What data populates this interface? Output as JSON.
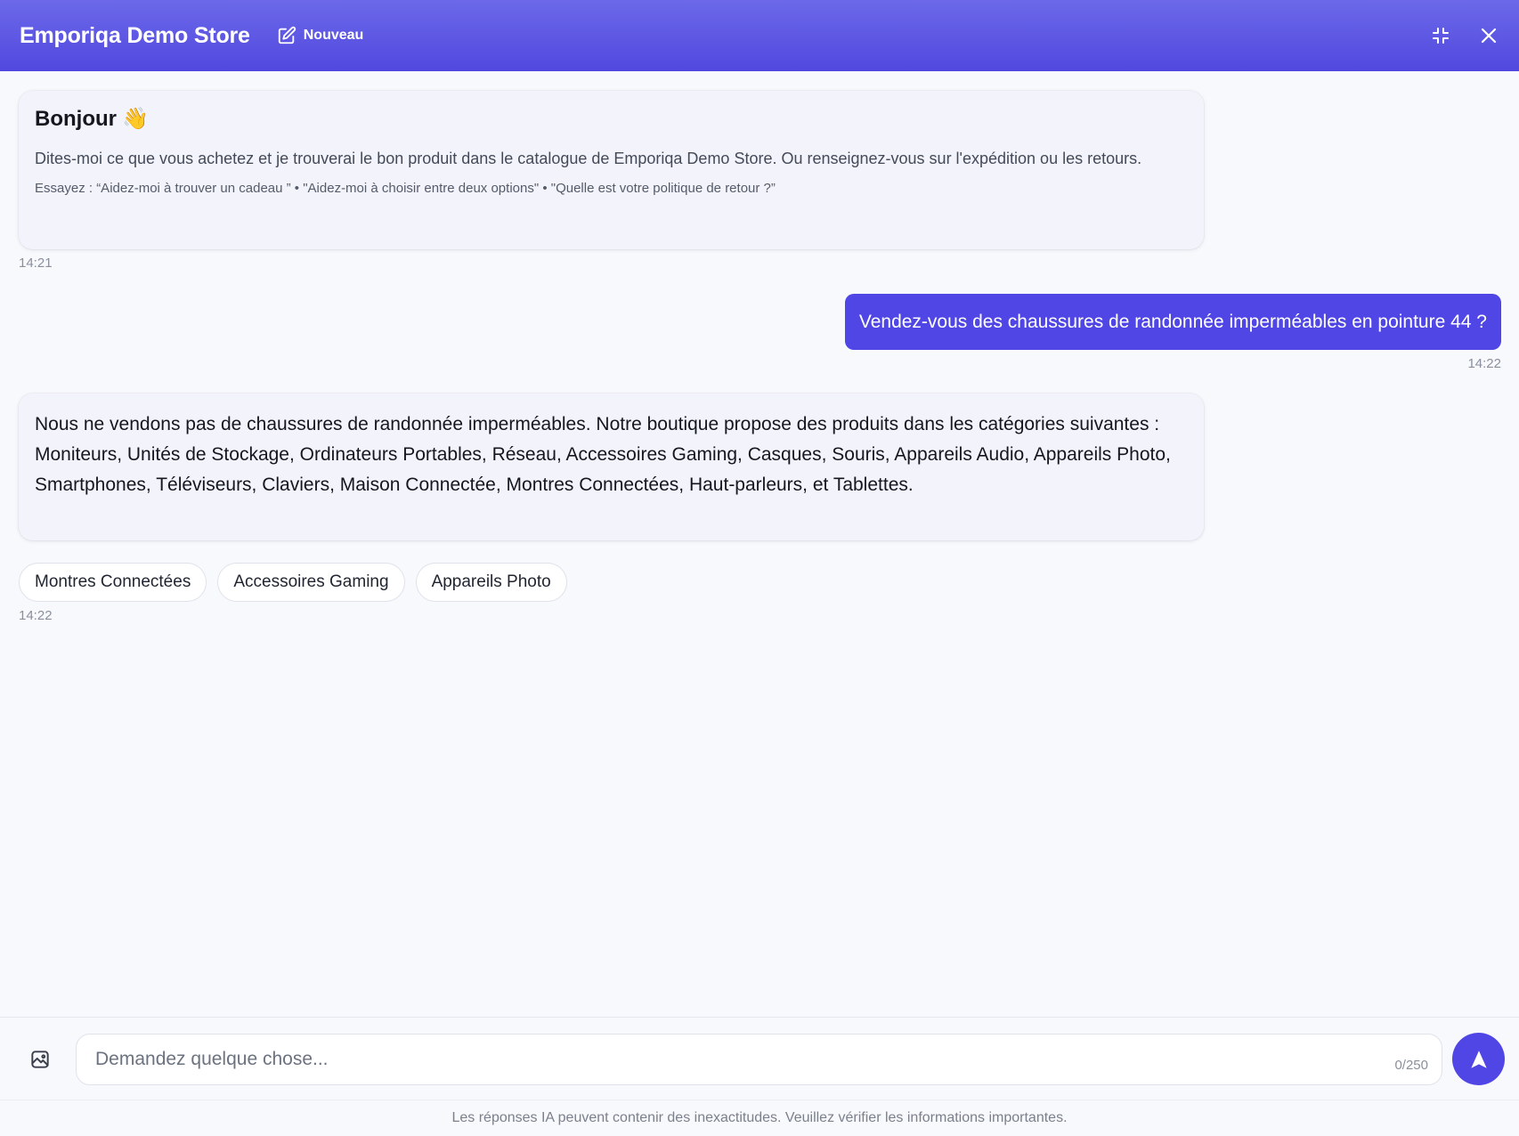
{
  "header": {
    "store_title": "Emporiqa Demo Store",
    "new_label": "Nouveau",
    "icons": [
      "edit-icon",
      "minimize-icon",
      "close-icon"
    ]
  },
  "welcome": {
    "title": "Bonjour",
    "emoji": "👋",
    "body": "Dites-moi ce que vous achetez et je trouverai le bon produit dans le catalogue de Emporiqa Demo Store. Ou renseignez-vous sur l'expédition ou les retours.",
    "try": "Essayez : “Aidez-moi à trouver un cadeau ” • \"Aidez-moi à choisir entre deux options\" • \"Quelle est votre politique de retour ?”",
    "time": "14:21"
  },
  "user_message": {
    "text": "Vendez-vous des chaussures de randonnée imperméables en pointure 44 ?",
    "time": "14:22"
  },
  "bot_answer": {
    "text": "Nous ne vendons pas de chaussures de randonnée imperméables. Notre boutique propose des produits dans les catégories suivantes : Moniteurs, Unités de Stockage, Ordinateurs Portables, Réseau, Accessoires Gaming, Casques, Souris, Appareils Audio, Appareils Photo, Smartphones, Téléviseurs, Claviers, Maison Connectée, Montres Connectées, Haut-parleurs, et Tablettes.",
    "time": "14:22",
    "suggestions": [
      "Montres Connectées",
      "Accessoires Gaming",
      "Appareils Photo"
    ]
  },
  "composer": {
    "placeholder": "Demandez quelque chose...",
    "value": "",
    "counter": "0/250",
    "icons": [
      "image-icon",
      "send-icon"
    ]
  },
  "disclaimer": "Les réponses IA peuvent contenir des inexactitudes. Veuillez vérifier les informations importantes.",
  "colors": {
    "accent": "#4f46e5",
    "header_gradient_top": "#6c69e9",
    "background": "#f8f9fc",
    "bot_bubble": "#f3f4fb"
  }
}
